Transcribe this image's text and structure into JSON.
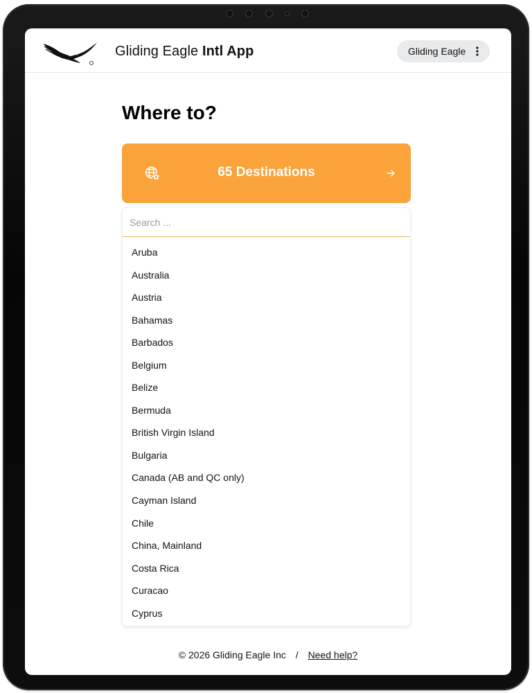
{
  "header": {
    "app_title_light": "Gliding Eagle",
    "app_title_bold": "Intl App",
    "user_menu_label": "Gliding Eagle",
    "logo_icon": "eagle-logo-icon"
  },
  "main": {
    "heading": "Where to?",
    "destinations_button": {
      "label": "65 Destinations",
      "icon": "globe-star-icon",
      "arrow_icon": "arrow-right-icon",
      "color": "#F9A33A"
    },
    "search": {
      "placeholder": "Search ...",
      "value": ""
    },
    "countries": [
      "Aruba",
      "Australia",
      "Austria",
      "Bahamas",
      "Barbados",
      "Belgium",
      "Belize",
      "Bermuda",
      "British Virgin Island",
      "Bulgaria",
      "Canada (AB and QC only)",
      "Cayman Island",
      "Chile",
      "China, Mainland",
      "Costa Rica",
      "Curacao",
      "Cyprus"
    ]
  },
  "footer": {
    "copyright": "© 2026 Gliding Eagle Inc",
    "separator": "/",
    "help_link": "Need help?"
  }
}
